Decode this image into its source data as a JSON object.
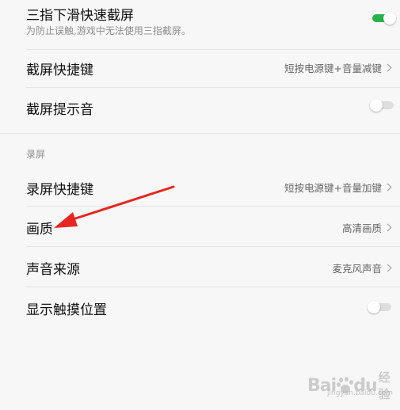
{
  "settings": {
    "three_finger": {
      "label": "三指下滑快速截屏",
      "subtitle": "为防止误触,游戏中无法使用三指截屏。",
      "enabled": true
    },
    "screenshot_shortcut": {
      "label": "截屏快捷键",
      "value": "短按电源键+音量减键"
    },
    "screenshot_sound": {
      "label": "截屏提示音",
      "enabled": false
    },
    "record_section": {
      "header": "录屏"
    },
    "record_shortcut": {
      "label": "录屏快捷键",
      "value": "短按电源键+音量加键"
    },
    "quality": {
      "label": "画质",
      "value": "高清画质"
    },
    "sound_source": {
      "label": "声音来源",
      "value": "麦克风声音"
    },
    "show_touch": {
      "label": "显示触摸位置",
      "enabled": false
    }
  },
  "annotation": {
    "arrow_color": "#e8261f"
  },
  "watermark": {
    "brand_b": "Bai",
    "brand_du": "du",
    "brand_cn": "经验",
    "url": "jingyan.baidu.com"
  },
  "colors": {
    "toggle_on": "#2bb14c",
    "toggle_off": "#dedede",
    "background": "#f7f7f7"
  }
}
